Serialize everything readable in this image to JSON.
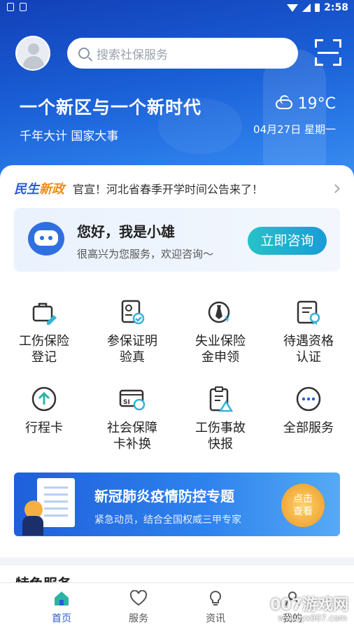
{
  "status_bar": {
    "time": "2:58"
  },
  "header": {
    "search_placeholder": "搜索社保服务",
    "headline": "一个新区与一个新时代",
    "subline": "千年大计 国家大事",
    "temperature": "19°C",
    "date": "04月27日 星期一"
  },
  "news": {
    "brand_a": "民生",
    "brand_b": "新政",
    "text": "官宣！河北省春季开学时间公告来了！"
  },
  "assistant": {
    "greeting": "您好，我是小雄",
    "subtitle": "很高兴为您服务，欢迎咨询～",
    "button": "立即咨询"
  },
  "services": [
    {
      "line1": "工伤保险",
      "line2": "登记",
      "icon": "briefcase-edit-icon"
    },
    {
      "line1": "参保证明",
      "line2": "验真",
      "icon": "id-card-check-icon"
    },
    {
      "line1": "失业保险",
      "line2": "金申领",
      "icon": "tie-money-icon"
    },
    {
      "line1": "待遇资格",
      "line2": "认证",
      "icon": "certificate-icon"
    },
    {
      "line1": "行程卡",
      "line2": "",
      "icon": "arrow-up-circle-icon"
    },
    {
      "line1": "社会保障",
      "line2": "卡补换",
      "icon": "si-card-refresh-icon"
    },
    {
      "line1": "工伤事故",
      "line2": "快报",
      "icon": "clipboard-warning-icon"
    },
    {
      "line1": "全部服务",
      "line2": "",
      "icon": "more-dots-icon"
    }
  ],
  "banner": {
    "title": "新冠肺炎疫情防控专题",
    "subtitle": "紧急动员，结合全国权威三甲专家",
    "cta_line1": "点击",
    "cta_line2": "查看"
  },
  "section": {
    "title": "特色服务"
  },
  "tabs": [
    {
      "label": "首页",
      "icon": "home-icon",
      "active": true
    },
    {
      "label": "服务",
      "icon": "heart-icon",
      "active": false
    },
    {
      "label": "资讯",
      "icon": "bulb-icon",
      "active": false
    },
    {
      "label": "我的",
      "icon": "user-icon",
      "active": false
    }
  ],
  "watermark": {
    "main": "007游戏网",
    "url": "www.yx007.com"
  },
  "colors": {
    "primary": "#2a5bd7",
    "accent": "#f28a1b",
    "teal": "#27c2c7"
  }
}
